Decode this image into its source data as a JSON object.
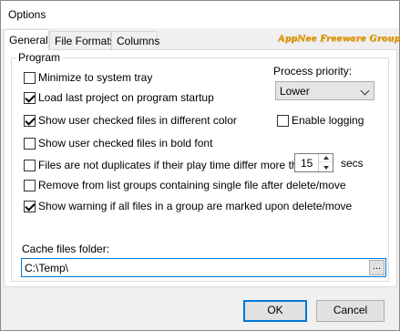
{
  "window": {
    "title": "Options"
  },
  "tabs": [
    {
      "label": "General",
      "active": true
    },
    {
      "label": "File Formats",
      "active": false
    },
    {
      "label": "Columns",
      "active": false
    }
  ],
  "watermark": "AppNee Freeware Group.",
  "program_group": {
    "legend": "Program",
    "minimize_tray": {
      "label": "Minimize to system tray",
      "checked": false
    },
    "load_last_project": {
      "label": "Load last project on program startup",
      "checked": true
    },
    "show_checked_color": {
      "label": "Show user checked files in different color",
      "checked": true
    },
    "show_checked_bold": {
      "label": "Show user checked files in bold font",
      "checked": false
    },
    "not_duplicates": {
      "label": "Files are not duplicates if their play time differ more than",
      "checked": false,
      "value": "15",
      "unit": "secs"
    },
    "remove_single": {
      "label": "Remove from list groups containing single file after delete/move",
      "checked": false
    },
    "show_warning": {
      "label": "Show warning if all files in a group are marked upon delete/move",
      "checked": true
    },
    "process_priority": {
      "label": "Process priority:",
      "selected": "Lower"
    },
    "enable_logging": {
      "label": "Enable logging",
      "checked": false
    },
    "cache_folder": {
      "label": "Cache files folder:",
      "value": "C:\\Temp\\",
      "browse_label": "..."
    }
  },
  "buttons": {
    "ok": "OK",
    "cancel": "Cancel"
  },
  "colors": {
    "accent": "#0078d7",
    "watermark": "#e8a000"
  }
}
